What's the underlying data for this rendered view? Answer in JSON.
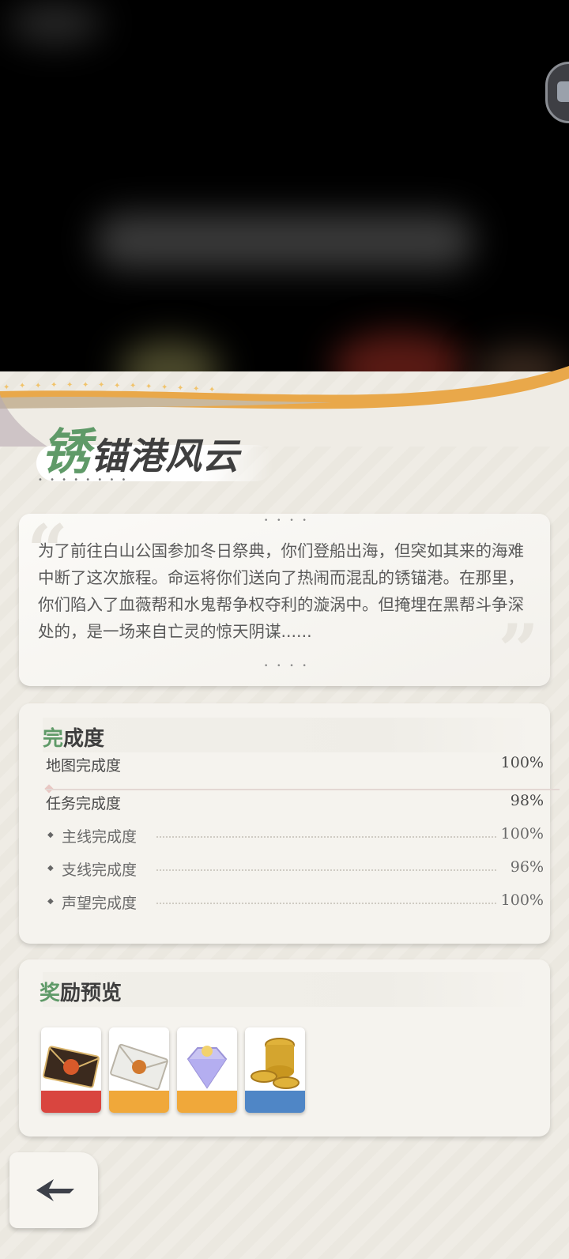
{
  "title": "锈锚港风云",
  "title_first_char": "锈",
  "title_rest": "锚港风云",
  "description": "为了前往白山公国参加冬日祭典，你们登船出海，但突如其来的海难中断了这次旅程。命运将你们送向了热闹而混乱的锈锚港。在那里，你们陷入了血薇帮和水鬼帮争权夺利的漩涡中。但掩埋在黑帮斗争深处的，是一场来自亡灵的惊天阴谋......",
  "completion": {
    "title_accent": "完",
    "title_rest": "成度",
    "map": {
      "label": "地图完成度",
      "value": "100%"
    },
    "quest": {
      "label": "任务完成度",
      "value": "98%"
    },
    "sub_items": [
      {
        "label": "主线完成度",
        "value": "100%"
      },
      {
        "label": "支线完成度",
        "value": "96%"
      },
      {
        "label": "声望完成度",
        "value": "100%"
      }
    ]
  },
  "rewards": {
    "title_accent": "奖",
    "title_rest": "励预览",
    "items": [
      {
        "icon": "red-sealed-envelope-icon",
        "rarity_color": "#d9453f"
      },
      {
        "icon": "white-sealed-envelope-icon",
        "rarity_color": "#f0a83a"
      },
      {
        "icon": "crystal-gem-icon",
        "rarity_color": "#f0a83a"
      },
      {
        "icon": "gold-coins-icon",
        "rarity_color": "#4f86c6"
      }
    ]
  },
  "colors": {
    "accent_green": "#5f9a68",
    "gold_band": "#e9a84a"
  },
  "icons": {
    "back": "back-arrow-icon",
    "side": "side-menu-icon"
  }
}
